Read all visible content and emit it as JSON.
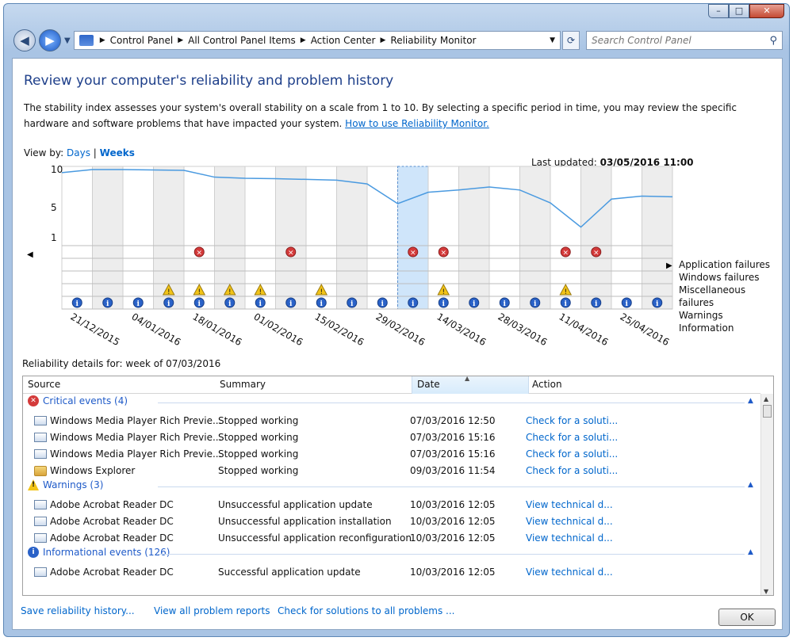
{
  "window": {
    "caption_buttons": {
      "minimize": "–",
      "maximize": "□",
      "close": "✕"
    }
  },
  "nav": {
    "back_icon": "arrow-left-icon",
    "forward_icon": "arrow-right-icon",
    "breadcrumbs": [
      "Control Panel",
      "All Control Panel Items",
      "Action Center",
      "Reliability Monitor"
    ],
    "search_placeholder": "Search Control Panel"
  },
  "header": {
    "title": "Review your computer's reliability and problem history",
    "description": "The stability index assesses your system's overall stability on a scale from 1 to 10. By selecting a specific period in time, you may review the specific hardware and software problems that have impacted your system.",
    "help_link": "How to use Reliability Monitor."
  },
  "view": {
    "label": "View by:",
    "days": "Days",
    "separator": "|",
    "weeks": "Weeks"
  },
  "last_updated": {
    "label": "Last updated:",
    "value": "03/05/2016 11:00"
  },
  "chart_data": {
    "type": "line",
    "title": "",
    "ylim": [
      1,
      10
    ],
    "y_ticks": [
      "10",
      "5",
      "1"
    ],
    "x_labels": [
      "21/12/2015",
      "04/01/2016",
      "18/01/2016",
      "01/02/2016",
      "15/02/2016",
      "29/02/2016",
      "14/03/2016",
      "28/03/2016",
      "11/04/2016",
      "25/04/2016"
    ],
    "weeks": 20,
    "selected_week": 11,
    "stability_index": [
      9.6,
      10.0,
      10.0,
      9.95,
      9.9,
      9.0,
      8.85,
      8.8,
      8.7,
      8.6,
      8.1,
      5.5,
      7.0,
      7.3,
      7.7,
      7.3,
      5.6,
      2.4,
      6.1,
      6.5,
      6.4
    ],
    "legend": [
      "Application failures",
      "Windows failures",
      "Miscellaneous failures",
      "Warnings",
      "Information"
    ],
    "application_failures": [
      4,
      7,
      11,
      12,
      16,
      17
    ],
    "warnings": [
      3,
      4,
      5,
      6,
      8,
      12,
      16
    ],
    "information": [
      0,
      1,
      2,
      3,
      4,
      5,
      6,
      7,
      8,
      9,
      10,
      11,
      12,
      13,
      14,
      15,
      16,
      17,
      18,
      19
    ]
  },
  "details": {
    "label": "Reliability details for: week of 07/03/2016",
    "columns": [
      "Source",
      "Summary",
      "Date",
      "Action"
    ],
    "groups": [
      {
        "title": "Critical events (4)",
        "rows": [
          {
            "source": "Windows Media Player Rich Previe...",
            "summary": "Stopped working",
            "date": "07/03/2016 12:50",
            "action": "Check for a soluti..."
          },
          {
            "source": "Windows Media Player Rich Previe...",
            "summary": "Stopped working",
            "date": "07/03/2016 15:16",
            "action": "Check for a soluti..."
          },
          {
            "source": "Windows Media Player Rich Previe...",
            "summary": "Stopped working",
            "date": "07/03/2016 15:16",
            "action": "Check for a soluti..."
          },
          {
            "source": "Windows Explorer",
            "summary": "Stopped working",
            "date": "09/03/2016 11:54",
            "action": "Check for a soluti..."
          }
        ]
      },
      {
        "title": "Warnings (3)",
        "rows": [
          {
            "source": "Adobe Acrobat Reader DC",
            "summary": "Unsuccessful application update",
            "date": "10/03/2016 12:05",
            "action": "View technical d..."
          },
          {
            "source": "Adobe Acrobat Reader DC",
            "summary": "Unsuccessful application installation",
            "date": "10/03/2016 12:05",
            "action": "View technical d..."
          },
          {
            "source": "Adobe Acrobat Reader DC",
            "summary": "Unsuccessful application reconfiguration",
            "date": "10/03/2016 12:05",
            "action": "View technical d..."
          }
        ]
      },
      {
        "title": "Informational events (126)",
        "rows": [
          {
            "source": "Adobe Acrobat Reader DC",
            "summary": "Successful application update",
            "date": "10/03/2016 12:05",
            "action": "View technical d..."
          }
        ]
      }
    ]
  },
  "footer": {
    "save_link": "Save reliability history...",
    "reports_link": "View all problem reports",
    "solutions_link": "Check for solutions to all problems ...",
    "ok": "OK"
  },
  "colors": {
    "link": "#0066cc",
    "title": "#1e3f8a",
    "line": "#4a9ae0",
    "selected": "#cfe5fa",
    "critical": "#d43a3a",
    "warning": "#f2c417",
    "info": "#2a62c8"
  }
}
